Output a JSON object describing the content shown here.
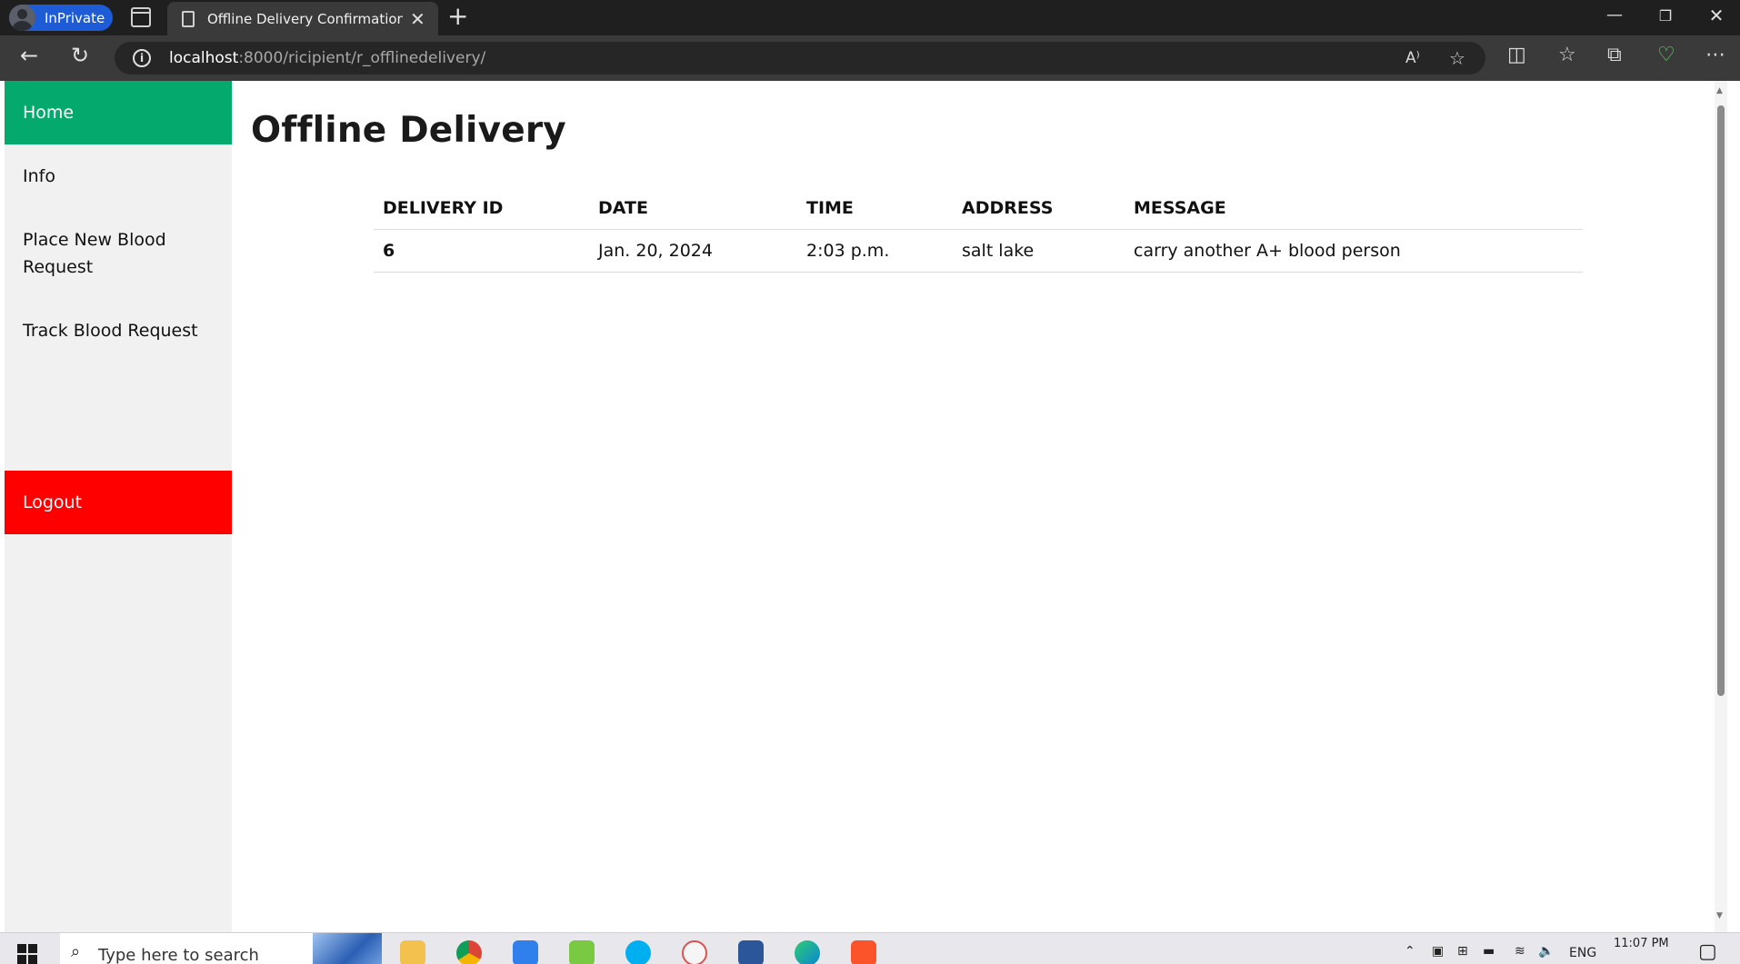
{
  "browser": {
    "profile_label": "InPrivate",
    "tab_title": "Offline Delivery Confirmation ~ F",
    "url_host": "localhost",
    "url_rest": ":8000/ricipient/r_offlinedelivery/"
  },
  "sidebar": {
    "items": [
      {
        "label": "Home"
      },
      {
        "label": "Info"
      },
      {
        "label": "Place New Blood Request"
      },
      {
        "label": "Track Blood Request"
      }
    ],
    "logout_label": "Logout"
  },
  "main": {
    "title": "Offline Delivery",
    "table": {
      "headers": [
        "DELIVERY ID",
        "DATE",
        "TIME",
        "ADDRESS",
        "MESSAGE"
      ],
      "rows": [
        {
          "delivery_id": "6",
          "date": "Jan. 20, 2024",
          "time": "2:03 p.m.",
          "address": "salt lake",
          "message": "carry another A+ blood person"
        }
      ]
    }
  },
  "taskbar": {
    "search_placeholder": "Type here to search",
    "language": "ENG",
    "time": "11:07 PM"
  },
  "colors": {
    "active_nav": "#04aa6d",
    "logout": "#ff0000",
    "profile_pill": "#1e5bd6"
  }
}
